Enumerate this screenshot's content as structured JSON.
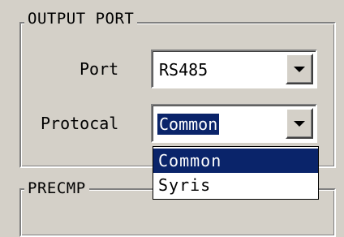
{
  "output_port": {
    "title": "OUTPUT PORT",
    "port_label": "Port",
    "port_value": "RS485",
    "protocol_label": "Protocal",
    "protocol_value": "Common",
    "protocol_options": [
      "Common",
      "Syris"
    ],
    "highlighted_option": "Common"
  },
  "precmp": {
    "title": "PRECMP"
  },
  "colors": {
    "window_bg": "#d4d0c8",
    "selection_bg": "#0a246a",
    "selection_text": "#ffffff"
  },
  "icons": {
    "dropdown_arrow": "chevron-down-icon"
  }
}
